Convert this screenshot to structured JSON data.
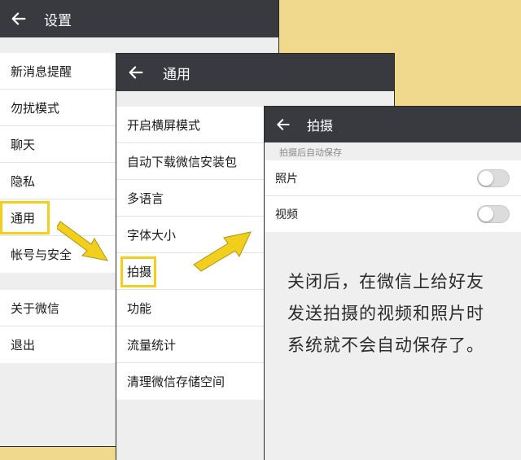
{
  "panel1": {
    "title": "设置",
    "group1": [
      "新消息提醒",
      "勿扰模式",
      "聊天",
      "隐私",
      "通用",
      "帐号与安全"
    ],
    "group2": [
      "关于微信",
      "退出"
    ]
  },
  "panel2": {
    "title": "通用",
    "items": [
      "开启横屏模式",
      "自动下载微信安装包",
      "多语言",
      "字体大小",
      "拍摄",
      "功能",
      "流量统计",
      "清理微信存储空间"
    ]
  },
  "panel3": {
    "title": "拍摄",
    "section_label": "拍摄后自动保存",
    "items": [
      {
        "label": "照片",
        "on": false
      },
      {
        "label": "视频",
        "on": false
      }
    ],
    "note_lines": [
      "关闭后，在微信上给好友",
      "发送拍摄的视频和照片时",
      "系统就不会自动保存了。"
    ]
  },
  "colors": {
    "header": "#393a3f",
    "highlight": "#f2cf1c",
    "background": "#f0d98c"
  }
}
